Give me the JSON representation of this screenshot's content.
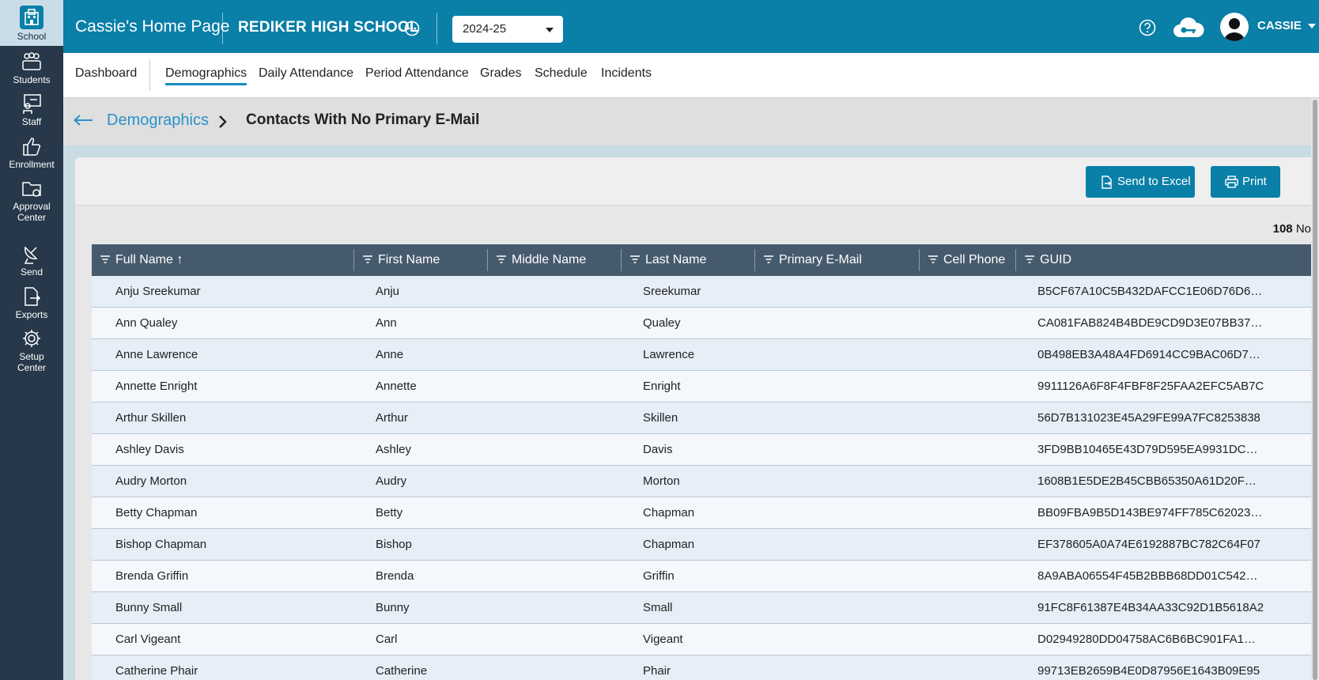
{
  "sidebar": {
    "items": [
      {
        "label": "School",
        "icon": "school-building-icon"
      },
      {
        "label": "Students",
        "icon": "students-group-icon"
      },
      {
        "label": "Staff",
        "icon": "staff-presenter-icon"
      },
      {
        "label": "Enrollment",
        "icon": "thumbs-up-icon"
      },
      {
        "label": "Approval Center",
        "icon": "folder-check-icon"
      },
      {
        "label": "Send",
        "icon": "satellite-dish-icon"
      },
      {
        "label": "Exports",
        "icon": "file-export-icon"
      },
      {
        "label": "Setup Center",
        "icon": "gear-icon"
      }
    ]
  },
  "header": {
    "title": "Cassie's Home Page",
    "school": "REDIKER HIGH SCHOOL",
    "year": "2024-25",
    "user": "CASSIE"
  },
  "nav": {
    "tabs": [
      "Dashboard",
      "Demographics",
      "Daily Attendance",
      "Period Attendance",
      "Grades",
      "Schedule",
      "Incidents"
    ],
    "active": "Demographics"
  },
  "breadcrumb": {
    "parent": "Demographics",
    "current": "Contacts With No Primary E-Mail"
  },
  "toolbar": {
    "excel": "Send to Excel",
    "print": "Print"
  },
  "count": {
    "value": "108",
    "suffix": "No"
  },
  "table": {
    "columns": [
      "Full Name ↑",
      "First Name",
      "Middle Name",
      "Last Name",
      "Primary E-Mail",
      "Cell Phone",
      "GUID"
    ],
    "rows": [
      [
        "Anju Sreekumar",
        "Anju",
        "",
        "Sreekumar",
        "",
        "",
        "B5CF67A10C5B432DAFCC1E06D76D6…"
      ],
      [
        "Ann Qualey",
        "Ann",
        "",
        "Qualey",
        "",
        "",
        "CA081FAB824B4BDE9CD9D3E07BB37…"
      ],
      [
        "Anne Lawrence",
        "Anne",
        "",
        "Lawrence",
        "",
        "",
        "0B498EB3A48A4FD6914CC9BAC06D7…"
      ],
      [
        "Annette Enright",
        "Annette",
        "",
        "Enright",
        "",
        "",
        "9911126A6F8F4FBF8F25FAA2EFC5AB7C"
      ],
      [
        "Arthur Skillen",
        "Arthur",
        "",
        "Skillen",
        "",
        "",
        "56D7B131023E45A29FE99A7FC8253838"
      ],
      [
        "Ashley Davis",
        "Ashley",
        "",
        "Davis",
        "",
        "",
        "3FD9BB10465E43D79D595EA9931DC…"
      ],
      [
        "Audry Morton",
        "Audry",
        "",
        "Morton",
        "",
        "",
        "1608B1E5DE2B45CBB65350A61D20F…"
      ],
      [
        "Betty Chapman",
        "Betty",
        "",
        "Chapman",
        "",
        "",
        "BB09FBA9B5D143BE974FF785C62023…"
      ],
      [
        "Bishop Chapman",
        "Bishop",
        "",
        "Chapman",
        "",
        "",
        "EF378605A0A74E6192887BC782C64F07"
      ],
      [
        "Brenda Griffin",
        "Brenda",
        "",
        "Griffin",
        "",
        "",
        "8A9ABA06554F45B2BBB68DD01C542…"
      ],
      [
        "Bunny Small",
        "Bunny",
        "",
        "Small",
        "",
        "",
        "91FC8F61387E4B34AA33C92D1B5618A2"
      ],
      [
        "Carl Vigeant",
        "Carl",
        "",
        "Vigeant",
        "",
        "",
        "D02949280DD04758AC6B6BC901FA1…"
      ],
      [
        "Catherine Phair",
        "Catherine",
        "",
        "Phair",
        "",
        "",
        "99713EB2659B4E0D87956E1643B09E95"
      ]
    ]
  }
}
